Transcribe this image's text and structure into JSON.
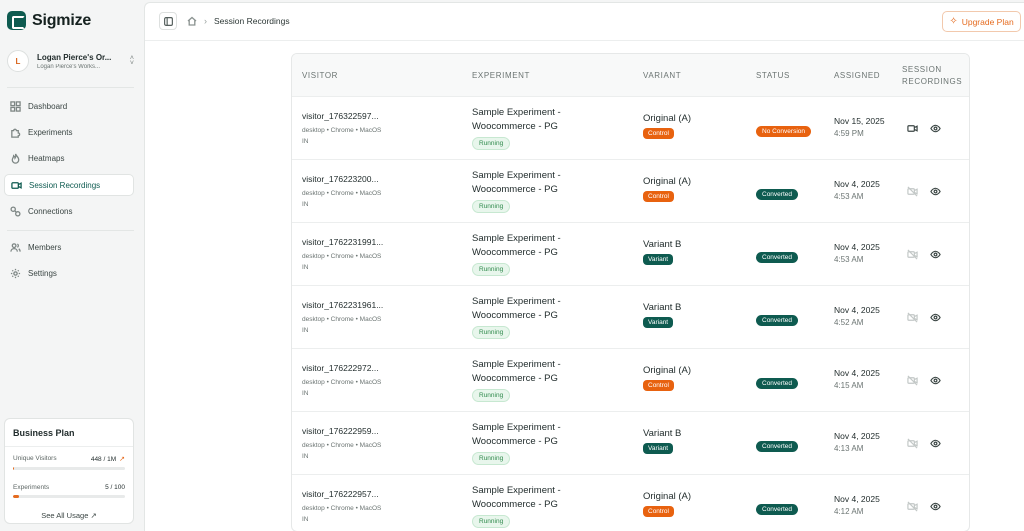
{
  "brand": {
    "name": "Sigmize",
    "color": "#0e5b50"
  },
  "workspace": {
    "initial": "L",
    "name": "Logan Pierce's Or...",
    "sub": "Logan Pierce's Works..."
  },
  "nav": [
    {
      "label": "Dashboard",
      "icon": "dashboard-icon"
    },
    {
      "label": "Experiments",
      "icon": "puzzle-icon"
    },
    {
      "label": "Heatmaps",
      "icon": "flame-icon"
    },
    {
      "label": "Session Recordings",
      "icon": "video-icon",
      "active": true
    },
    {
      "label": "Connections",
      "icon": "link-icon"
    },
    {
      "label": "Members",
      "icon": "users-icon"
    },
    {
      "label": "Settings",
      "icon": "gear-icon"
    }
  ],
  "plan": {
    "title": "Business Plan",
    "visitors_label": "Unique Visitors",
    "visitors_value": "448 / 1M",
    "visitors_fraction": 0.000448,
    "experiments_label": "Experiments",
    "experiments_value": "5 / 100",
    "experiments_fraction": 0.05,
    "see_all": "See All Usage ↗"
  },
  "breadcrumb": {
    "current": "Session Recordings"
  },
  "upgrade_label": "Upgrade Plan",
  "accent": "#e56b1f",
  "table": {
    "headers": {
      "visitor": "VISITOR",
      "experiment": "EXPERIMENT",
      "variant": "VARIANT",
      "status": "STATUS",
      "assigned": "ASSIGNED",
      "recordings_1": "SESSION",
      "recordings_2": "RECORDINGS"
    },
    "rows": [
      {
        "visitor": "visitor_176322597...",
        "meta": "desktop • Chrome • MacOS",
        "country": "IN",
        "experiment": "Sample Experiment - Woocommerce - PG",
        "exp_status": "Running",
        "variant": "Original (A)",
        "variant_badge": "Control",
        "status": "No Conversion",
        "date": "Nov 15, 2025",
        "time": "4:59 PM",
        "has_recording": true
      },
      {
        "visitor": "visitor_176223200...",
        "meta": "desktop • Chrome • MacOS",
        "country": "IN",
        "experiment": "Sample Experiment - Woocommerce - PG",
        "exp_status": "Running",
        "variant": "Original (A)",
        "variant_badge": "Control",
        "status": "Converted",
        "date": "Nov 4, 2025",
        "time": "4:53 AM",
        "has_recording": false
      },
      {
        "visitor": "visitor_1762231991...",
        "meta": "desktop • Chrome • MacOS",
        "country": "IN",
        "experiment": "Sample Experiment - Woocommerce - PG",
        "exp_status": "Running",
        "variant": "Variant B",
        "variant_badge": "Variant",
        "status": "Converted",
        "date": "Nov 4, 2025",
        "time": "4:53 AM",
        "has_recording": false
      },
      {
        "visitor": "visitor_1762231961...",
        "meta": "desktop • Chrome • MacOS",
        "country": "IN",
        "experiment": "Sample Experiment - Woocommerce - PG",
        "exp_status": "Running",
        "variant": "Variant B",
        "variant_badge": "Variant",
        "status": "Converted",
        "date": "Nov 4, 2025",
        "time": "4:52 AM",
        "has_recording": false
      },
      {
        "visitor": "visitor_176222972...",
        "meta": "desktop • Chrome • MacOS",
        "country": "IN",
        "experiment": "Sample Experiment - Woocommerce - PG",
        "exp_status": "Running",
        "variant": "Original (A)",
        "variant_badge": "Control",
        "status": "Converted",
        "date": "Nov 4, 2025",
        "time": "4:15 AM",
        "has_recording": false
      },
      {
        "visitor": "visitor_176222959...",
        "meta": "desktop • Chrome • MacOS",
        "country": "IN",
        "experiment": "Sample Experiment - Woocommerce - PG",
        "exp_status": "Running",
        "variant": "Variant B",
        "variant_badge": "Variant",
        "status": "Converted",
        "date": "Nov 4, 2025",
        "time": "4:13 AM",
        "has_recording": false
      },
      {
        "visitor": "visitor_176222957...",
        "meta": "desktop • Chrome • MacOS",
        "country": "IN",
        "experiment": "Sample Experiment - Woocommerce - PG",
        "exp_status": "Running",
        "variant": "Original (A)",
        "variant_badge": "Control",
        "status": "Converted",
        "date": "Nov 4, 2025",
        "time": "4:12 AM",
        "has_recording": false
      }
    ]
  },
  "colors": {
    "control": "#e8620f",
    "variant": "#0e5b50",
    "converted": "#0e5b50",
    "no_conversion": "#e8620f"
  }
}
